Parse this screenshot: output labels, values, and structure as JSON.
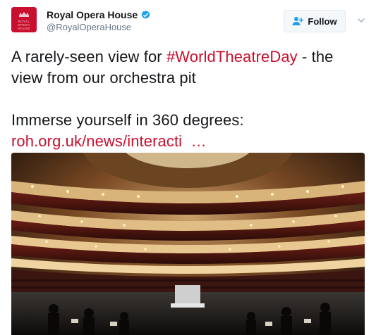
{
  "author": {
    "display_name": "Royal Opera House",
    "handle": "@RoyalOperaHouse",
    "verified": true,
    "avatar_text": [
      "ROYAL",
      "OPERA",
      "HOUSE"
    ],
    "avatar_color": "#c8102e"
  },
  "actions": {
    "follow_label": "Follow",
    "menu_icon": "chevron-down-icon"
  },
  "tweet": {
    "line1_prefix": "A rarely-seen view for ",
    "hashtag": "#WorldTheatreDay",
    "line1_suffix": " - the view from our orchestra pit",
    "line2": "Immerse yourself in 360 degrees:",
    "link": "roh.org.uk/news/interacti",
    "link_ellipsis": "…"
  },
  "colors": {
    "accent": "#c8102e",
    "verified": "#1da1f2",
    "text": "#14171a",
    "secondary": "#657786"
  },
  "media": {
    "kind": "photo",
    "subject": "opera-house-auditorium"
  }
}
